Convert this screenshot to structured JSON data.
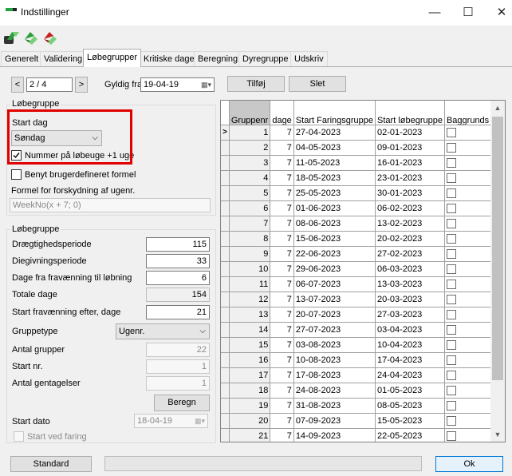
{
  "window": {
    "title": "Indstillinger",
    "minimize": "—",
    "maximize": "☐",
    "close": "✕"
  },
  "toolbar": {
    "icons": [
      "add-icon",
      "refresh-icon",
      "delete-icon"
    ]
  },
  "tabs": [
    "Generelt",
    "Validering",
    "Løbegrupper",
    "Kritiske dage",
    "Beregning",
    "Dyregruppe",
    "Udskriv"
  ],
  "active_tab": "Løbegrupper",
  "nav": {
    "prev": "<",
    "page": "2 / 4",
    "next": ">",
    "valid_from_label": "Gyldig fra",
    "valid_from_value": "19-04-19",
    "add_btn": "Tilføj",
    "delete_btn": "Slet"
  },
  "group1": {
    "title": "Løbegruppe",
    "start_day_label": "Start dag",
    "start_day_value": "Søndag",
    "week_plus_one_label": "Nummer på løbeuge +1 uge",
    "week_plus_one_checked": true,
    "custom_formula_label": "Benyt brugerdefineret formel",
    "formula_label": "Formel for forskydning af ugenr.",
    "formula_value": "WeekNo(x + 7; 0)"
  },
  "group2": {
    "title": "Løbegruppe",
    "fields": [
      {
        "label": "Drægtighedsperiode",
        "value": "115"
      },
      {
        "label": "Diegivningsperiode",
        "value": "33"
      },
      {
        "label": "Dage fra fravænning til løbning",
        "value": "6"
      },
      {
        "label": "Totale dage",
        "value": "154"
      },
      {
        "label": "Start fravænning efter, dage",
        "value": "21"
      }
    ],
    "group_type_label": "Gruppetype",
    "group_type_value": "Ugenr.",
    "count_label": "Antal grupper",
    "count_value": "22",
    "start_nr_label": "Start nr.",
    "start_nr_value": "1",
    "repeats_label": "Antal gentagelser",
    "repeats_value": "1",
    "calc_btn": "Beregn",
    "start_date_label": "Start dato",
    "start_date_value": "18-04-19",
    "start_farrowing_label": "Start ved faring"
  },
  "grid": {
    "headers": [
      "Gruppenr",
      "dage",
      "Start Faringsgruppe",
      "Start løbegruppe",
      "Baggrunds farve"
    ],
    "current_row_marker": ">",
    "rows": [
      [
        "1",
        "7",
        "27-04-2023",
        "02-01-2023"
      ],
      [
        "2",
        "7",
        "04-05-2023",
        "09-01-2023"
      ],
      [
        "3",
        "7",
        "11-05-2023",
        "16-01-2023"
      ],
      [
        "4",
        "7",
        "18-05-2023",
        "23-01-2023"
      ],
      [
        "5",
        "7",
        "25-05-2023",
        "30-01-2023"
      ],
      [
        "6",
        "7",
        "01-06-2023",
        "06-02-2023"
      ],
      [
        "7",
        "7",
        "08-06-2023",
        "13-02-2023"
      ],
      [
        "8",
        "7",
        "15-06-2023",
        "20-02-2023"
      ],
      [
        "9",
        "7",
        "22-06-2023",
        "27-02-2023"
      ],
      [
        "10",
        "7",
        "29-06-2023",
        "06-03-2023"
      ],
      [
        "11",
        "7",
        "06-07-2023",
        "13-03-2023"
      ],
      [
        "12",
        "7",
        "13-07-2023",
        "20-03-2023"
      ],
      [
        "13",
        "7",
        "20-07-2023",
        "27-03-2023"
      ],
      [
        "14",
        "7",
        "27-07-2023",
        "03-04-2023"
      ],
      [
        "15",
        "7",
        "03-08-2023",
        "10-04-2023"
      ],
      [
        "16",
        "7",
        "10-08-2023",
        "17-04-2023"
      ],
      [
        "17",
        "7",
        "17-08-2023",
        "24-04-2023"
      ],
      [
        "18",
        "7",
        "24-08-2023",
        "01-05-2023"
      ],
      [
        "19",
        "7",
        "31-08-2023",
        "08-05-2023"
      ],
      [
        "20",
        "7",
        "07-09-2023",
        "15-05-2023"
      ],
      [
        "21",
        "7",
        "14-09-2023",
        "22-05-2023"
      ]
    ]
  },
  "footer": {
    "standard_btn": "Standard",
    "ok_btn": "Ok"
  },
  "colors": {
    "highlight_box": "#e00000",
    "selected_header": "#c8c8c8",
    "accent_blue": "#0078d7"
  }
}
